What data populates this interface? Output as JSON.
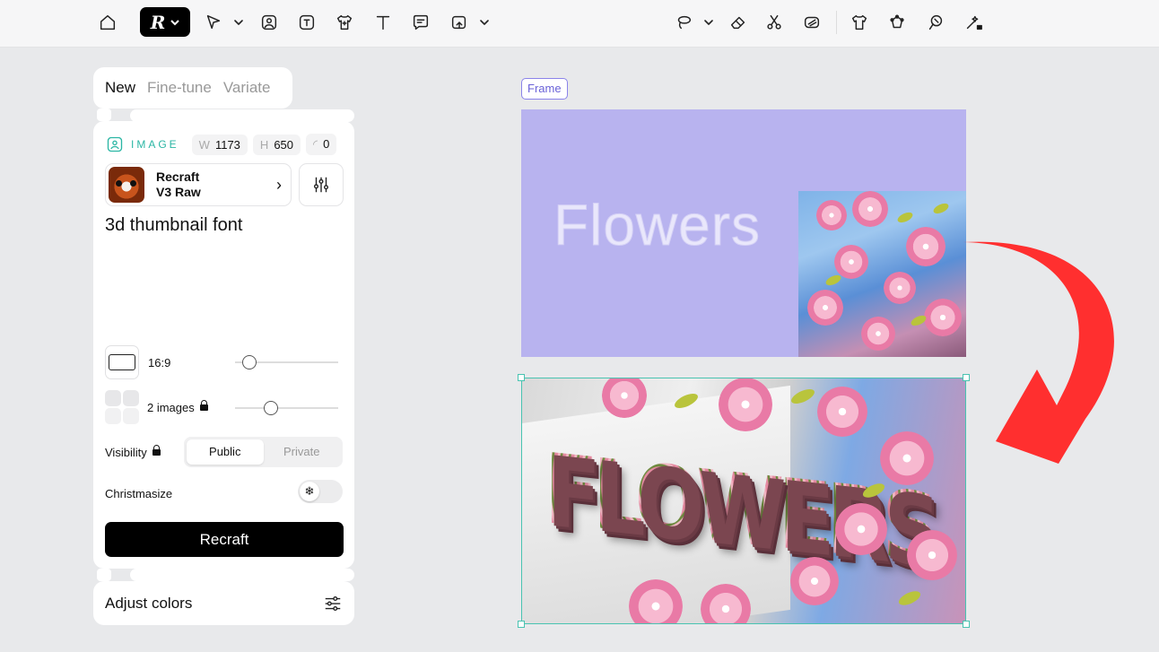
{
  "toolbar": {
    "brand_logo": "R",
    "left_icons": [
      "home-icon",
      "select-arrow-icon",
      "image-icon",
      "text-image-icon",
      "tshirt-icon",
      "text-icon",
      "comment-icon",
      "upscale-image-icon"
    ],
    "right_icons": [
      "lasso-icon",
      "eraser-icon",
      "scissors-icon",
      "remove-bg-icon",
      "mockup-tshirt-icon",
      "vectorize-icon",
      "style-brush-icon",
      "magic-wand-locked-icon"
    ]
  },
  "left_panel": {
    "tabs": [
      {
        "label": "New",
        "active": true
      },
      {
        "label": "Fine-tune",
        "active": false
      },
      {
        "label": "Variate",
        "active": false
      }
    ],
    "image_type_label": "IMAGE",
    "width_key": "W",
    "width_value": "1173",
    "height_key": "H",
    "height_value": "650",
    "radius_value": "0",
    "model": {
      "line1": "Recraft",
      "line2": "V3 Raw"
    },
    "prompt": "3d thumbnail font",
    "aspect_ratio": "16:9",
    "aspect_slider_value": 0.1,
    "images_count": "2 images",
    "images_slider_value": 0.33,
    "visibility_label": "Visibility",
    "visibility_options": [
      "Public",
      "Private"
    ],
    "visibility_selected": "Public",
    "christmasize_label": "Christmasize",
    "christmasize_on": false,
    "generate_button": "Recraft",
    "adjust_colors_label": "Adjust colors"
  },
  "canvas": {
    "frame_label": "Frame",
    "frame_text": "Flowers",
    "frame_bg_color": "#b8b3ef",
    "result_text": "FLOWERS",
    "selection_color": "#49c3b1",
    "arrow_color": "#ff2f2f"
  }
}
